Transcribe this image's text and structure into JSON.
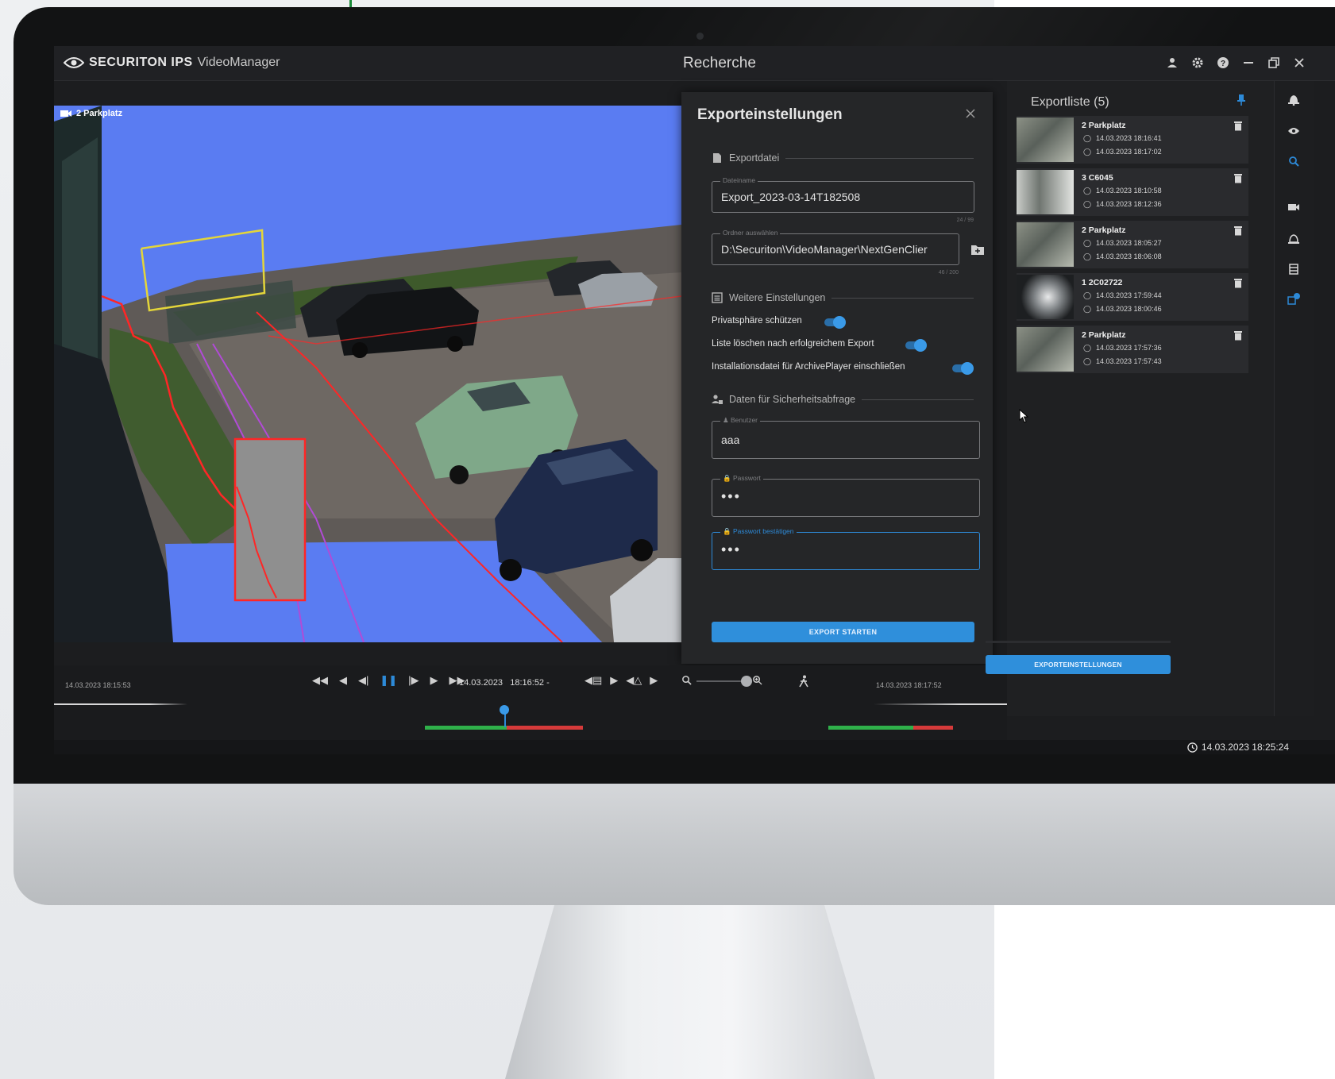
{
  "app": {
    "brand_bold": "SECURITON IPS",
    "brand_light": "VideoManager",
    "view_title": "Recherche",
    "title_icons": [
      "user-icon",
      "gear-icon",
      "help-icon",
      "minimize-icon",
      "restore-icon",
      "close-icon"
    ]
  },
  "video": {
    "camera_label": "2 Parkplatz"
  },
  "dialog": {
    "title": "Exporteinstellungen",
    "sections": {
      "file": "Exportdatei",
      "more": "Weitere Einstellungen",
      "security": "Daten für Sicherheitsabfrage"
    },
    "filename": {
      "legend": "Dateiname",
      "value": "Export_2023-03-14T182508",
      "counter": "24 / 99"
    },
    "folder": {
      "legend": "Ordner auswählen",
      "value": "D:\\Securiton\\VideoManager\\NextGenClier",
      "counter": "46 / 200"
    },
    "toggles": [
      {
        "label": "Privatsphäre schützen",
        "on": true
      },
      {
        "label": "Liste löschen nach erfolgreichem Export",
        "on": true
      },
      {
        "label": "Installationsdatei für ArchivePlayer einschließen",
        "on": true
      }
    ],
    "user": {
      "legend": "Benutzer",
      "value": "aaa"
    },
    "password": {
      "legend": "Passwort",
      "value": "•••"
    },
    "password_confirm": {
      "legend": "Passwort bestätigen",
      "value": "•••"
    },
    "start_button": "EXPORT STARTEN"
  },
  "exportlist": {
    "title": "Exportliste (5)",
    "items": [
      {
        "name": "2  Parkplatz",
        "start": "14.03.2023 18:16:41",
        "end": "14.03.2023 18:17:02"
      },
      {
        "name": "3  C6045",
        "start": "14.03.2023 18:10:58",
        "end": "14.03.2023 18:12:36"
      },
      {
        "name": "2  Parkplatz",
        "start": "14.03.2023 18:05:27",
        "end": "14.03.2023 18:06:08"
      },
      {
        "name": "1  2C02722",
        "start": "14.03.2023 17:59:44",
        "end": "14.03.2023 18:00:46"
      },
      {
        "name": "2  Parkplatz",
        "start": "14.03.2023 17:57:36",
        "end": "14.03.2023 17:57:43"
      }
    ],
    "export_settings_button": "EXPORTEINSTELLUNGEN"
  },
  "playback": {
    "left_time": "14.03.2023 18:15:53",
    "center_date": "14.03.2023",
    "center_time": "18:16:52 -",
    "right_time": "14.03.2023 18:17:52",
    "zoom_level": 1.0
  },
  "status": {
    "clock": "14.03.2023 18:25:24"
  },
  "colors": {
    "accent": "#2f8fdb",
    "privacy_mask": "#5a7cf2",
    "timeline_green": "#2fb14a",
    "timeline_red": "#d63a3a",
    "panel": "#252628"
  }
}
